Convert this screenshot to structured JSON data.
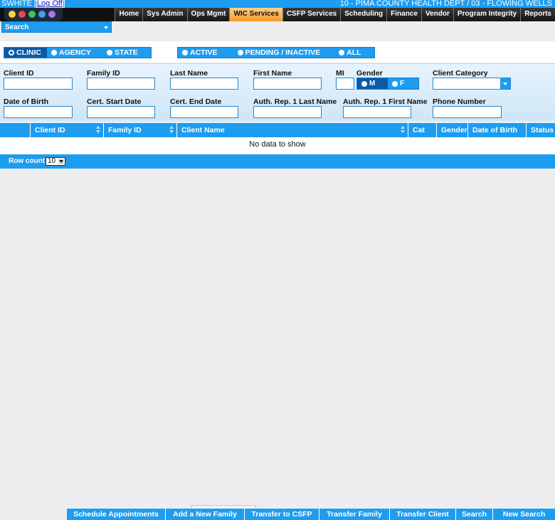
{
  "header": {
    "user": "SWHITE",
    "logoff": "Log Off",
    "location": "10 - PIMA COUNTY HEALTH DEPT / 03 - FLOWING WELLS"
  },
  "nav": {
    "tabs": [
      "Home",
      "Sys Admin",
      "Ops Mgmt",
      "WIC Services",
      "CSFP Services",
      "Scheduling",
      "Finance",
      "Vendor",
      "Program Integrity",
      "Reports"
    ],
    "active": "WIC Services"
  },
  "search_dropdown": {
    "label": "Search"
  },
  "scope_options": {
    "clinic": "CLINIC",
    "agency": "AGENCY",
    "state": "STATE",
    "selected": "CLINIC"
  },
  "status_options": {
    "active": "ACTIVE",
    "pending": "PENDING / INACTIVE",
    "all": "ALL"
  },
  "filters": {
    "client_id": "Client ID",
    "family_id": "Family ID",
    "last_name": "Last Name",
    "first_name": "First Name",
    "mi": "MI",
    "gender": "Gender",
    "gender_m": "M",
    "gender_f": "F",
    "client_category": "Client Category",
    "dob": "Date of Birth",
    "cert_start": "Cert. Start Date",
    "cert_end": "Cert. End Date",
    "auth_last": "Auth. Rep. 1 Last Name",
    "auth_first": "Auth. Rep. 1 First Name",
    "phone": "Phone Number"
  },
  "grid": {
    "columns": [
      "Client ID",
      "Family ID",
      "Client Name",
      "Cat",
      "Gender",
      "Date of Birth",
      "Status"
    ],
    "empty_message": "No data to show",
    "row_count_label": "Row count:",
    "row_count_value": "10"
  },
  "actions": [
    "Schedule Appointments",
    "Add a New Family",
    "Transfer to CSFP",
    "Transfer Family",
    "Transfer Client",
    "Search",
    "New Search"
  ],
  "colors": {
    "primary_blue": "#1e9cf0",
    "selected_blue": "#0a5aa8",
    "active_tab": "#f59a2a"
  }
}
